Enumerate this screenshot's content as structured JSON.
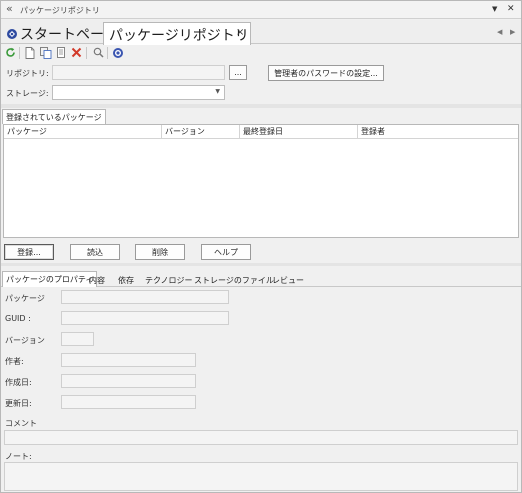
{
  "panel": {
    "title": "パッケージリポジトリ",
    "collapse_icon": "double-chevron-left-icon",
    "menu_icon": "dropdown-arrow-icon",
    "pin_icon": "pin-icon"
  },
  "doc_tabs": [
    {
      "label": "スタートページ",
      "icon": "start-page-icon",
      "active": false
    },
    {
      "label": "パッケージリポジトリ",
      "active": true,
      "close_glyph": "×"
    }
  ],
  "toolbar": {
    "icons": [
      "refresh-icon",
      "new-icon",
      "copy-icon",
      "edit-icon",
      "delete-icon",
      "search-icon",
      "settings-icon"
    ]
  },
  "form": {
    "repository_label": "リポジトリ:",
    "repository_value": "",
    "browse_button": "...",
    "admin_password_button": "管理者のパスワードの設定...",
    "storage_label": "ストレージ:",
    "storage_value": ""
  },
  "registered": {
    "tab_label": "登録されているパッケージ",
    "columns": [
      "パッケージ",
      "バージョン",
      "最終登録日",
      "登録者"
    ],
    "rows": []
  },
  "actions": {
    "register": "登録...",
    "load": "読込",
    "delete": "削除",
    "help": "ヘルプ"
  },
  "detail_tabs": [
    "パッケージのプロパティ",
    "内容",
    "依存",
    "テクノロジー",
    "ストレージのファイル",
    "レビュー"
  ],
  "properties": {
    "package_label": "パッケージ",
    "guid_label": "GUID :",
    "version_label": "バージョン",
    "author_label": "作者:",
    "created_label": "作成日:",
    "updated_label": "更新日:",
    "comment_label": "コメント",
    "note_label": "ノート:"
  }
}
